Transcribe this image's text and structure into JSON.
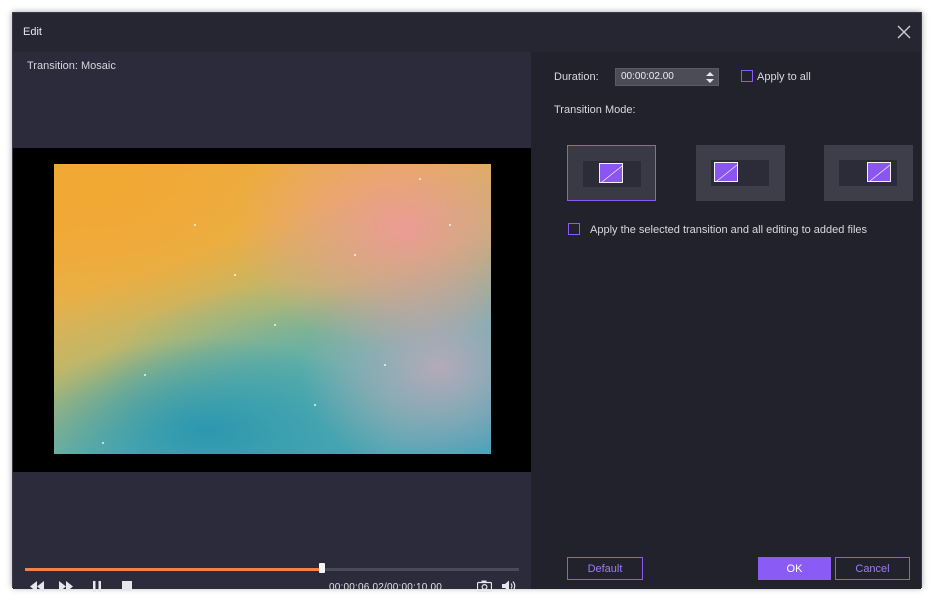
{
  "window": {
    "title": "Edit"
  },
  "preview": {
    "transition_label": "Transition: Mosaic",
    "progress": 0.602,
    "time_display": "00:00:06.02/00:00:10.00"
  },
  "settings": {
    "duration_label": "Duration:",
    "duration_value": "00:00:02.00",
    "apply_to_all_label": "Apply to all",
    "apply_to_all_checked": false,
    "transition_mode_label": "Transition Mode:",
    "transition_modes": [
      {
        "name": "center",
        "selected": true
      },
      {
        "name": "left",
        "selected": false
      },
      {
        "name": "right",
        "selected": false
      }
    ],
    "apply_selected_label": "Apply the selected transition and all editing to added files",
    "apply_selected_checked": false
  },
  "buttons": {
    "default_label": "Default",
    "ok_label": "OK",
    "cancel_label": "Cancel"
  },
  "icons": {
    "close": "close-icon",
    "rewind": "rewind-icon",
    "forward": "fast-forward-icon",
    "pause": "pause-icon",
    "stop": "stop-icon",
    "snapshot": "camera-icon",
    "volume": "volume-icon",
    "spinner": "spinner-arrows-icon"
  },
  "colors": {
    "accent": "#8a5cf5",
    "progress": "#f0824a",
    "background": "#22222c",
    "preview_background": "#2c2b3b"
  }
}
